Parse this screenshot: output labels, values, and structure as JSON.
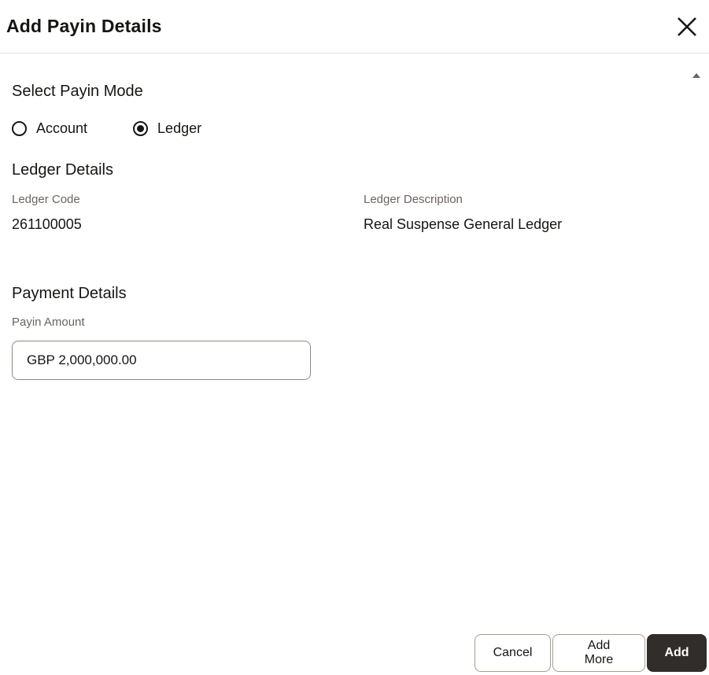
{
  "dialog": {
    "title": "Add Payin Details"
  },
  "payin_mode": {
    "heading": "Select Payin Mode",
    "options": [
      {
        "label": "Account",
        "selected": false
      },
      {
        "label": "Ledger",
        "selected": true
      }
    ]
  },
  "ledger_details": {
    "heading": "Ledger Details",
    "fields": [
      {
        "label": "Ledger Code",
        "value": "261100005"
      },
      {
        "label": "Ledger Description",
        "value": "Real Suspense General Ledger"
      }
    ]
  },
  "payment_details": {
    "heading": "Payment Details",
    "amount_label": "Payin Amount",
    "amount_value": "GBP 2,000,000.00"
  },
  "footer": {
    "cancel_label": "Cancel",
    "add_more_label": "Add More",
    "add_label": "Add"
  },
  "colors": {
    "text_primary": "#161513",
    "text_secondary": "#6b6460",
    "divider": "#e5e2df",
    "input_border": "#8e8882",
    "secondary_button_border": "#a49d96",
    "primary_button_bg": "#312d2a"
  }
}
